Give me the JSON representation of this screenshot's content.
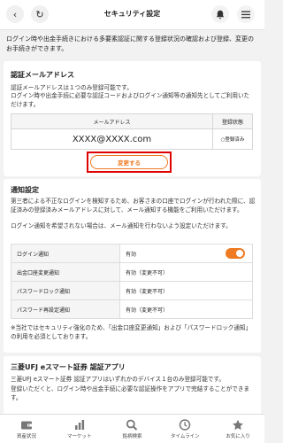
{
  "header": {
    "title": "セキュリティ設定",
    "back_icon": "back-icon",
    "refresh_icon": "refresh-icon",
    "bell_icon": "bell-icon",
    "menu_icon": "menu-icon"
  },
  "intro": "ログイン時や出金手続きにおける多要素認証に関する登録状況の確認および登録、変更のお手続きができます。",
  "email_section": {
    "title": "認証メールアドレス",
    "desc1": "認証メールアドレスは１つのみ登録可能です。",
    "desc2": "ログイン時や出金手続に必要な認証コードおよびログイン通知等の通知先としてご利用いただけます。",
    "col_address": "メールアドレス",
    "col_status": "登録状態",
    "address": "XXXX@XXXX.com",
    "status": "○登録済み",
    "change_button": "変更する"
  },
  "notify_section": {
    "title": "通知設定",
    "desc1": "第三者による不正なログインを検知するため、お客さまの口座でログインが行われた際に、認証済みの登録済みメールアドレスに対して、メール通知する機能をご利用いただけます。",
    "desc2": "ログイン通知を希望されない場合は、メール通知を行わないよう設定いただけます。",
    "rows": [
      {
        "label": "ログイン通知",
        "value": "有効"
      },
      {
        "label": "出金口座変更通知",
        "value": "有効（変更不可）"
      },
      {
        "label": "パスワードロック通知",
        "value": "有効（変更不可）"
      },
      {
        "label": "パスワード再設定通知",
        "value": "有効（変更不可）"
      }
    ],
    "note": "※当社ではセキュリティ強化のため、「出金口座変更通知」および「パスワードロック通知」の利用を必須としております。"
  },
  "app_section": {
    "title": "三菱UFJ eスマート証券 認証アプリ",
    "desc1": "三菱UFJ eスマート証券 認証アプリはいずれかのデバイス１台のみ登録可能です。",
    "desc2": "登録いただくと、ログイン時や出金手続に必要な認証操作をアプリで完結することができます。"
  },
  "bottom_nav": [
    {
      "label": "資産状況",
      "icon": "wallet-icon"
    },
    {
      "label": "マーケット",
      "icon": "market-chart-icon"
    },
    {
      "label": "銘柄検索",
      "icon": "search-icon"
    },
    {
      "label": "タイムライン",
      "icon": "clock-icon"
    },
    {
      "label": "お気に入り",
      "icon": "star-icon"
    }
  ],
  "colors": {
    "accent": "#ee7a22",
    "highlight": "#e00000"
  }
}
